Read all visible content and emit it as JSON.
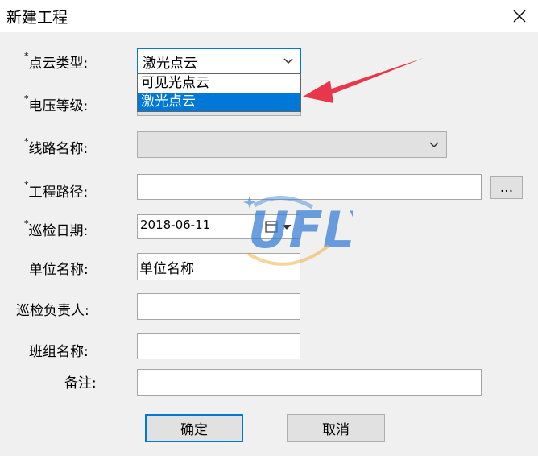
{
  "window": {
    "title": "新建工程",
    "close_icon": "close-icon"
  },
  "form": {
    "required_mark": "*",
    "point_cloud_type": {
      "label": "点云类型:",
      "value": "激光点云",
      "options": [
        "可见光点云",
        "激光点云"
      ],
      "selected_index": 1
    },
    "voltage_level": {
      "label": "电压等级:",
      "value": ""
    },
    "line_name": {
      "label": "线路名称:",
      "value": ""
    },
    "project_path": {
      "label": "工程路径:",
      "value": "",
      "browse_label": "..."
    },
    "inspection_date": {
      "label": "巡检日期:",
      "value": "2018-06-11"
    },
    "unit_name": {
      "label": "单位名称:",
      "value": "单位名称"
    },
    "inspector": {
      "label": "巡检负责人:",
      "value": ""
    },
    "team_name": {
      "label": "班组名称:",
      "value": ""
    },
    "remark": {
      "label": "备注:",
      "value": ""
    }
  },
  "buttons": {
    "ok": "确定",
    "cancel": "取消"
  },
  "watermark": {
    "text": "UFLY",
    "color": "#3a7fd5"
  },
  "annotation": {
    "arrow_color": "#e8374a"
  }
}
